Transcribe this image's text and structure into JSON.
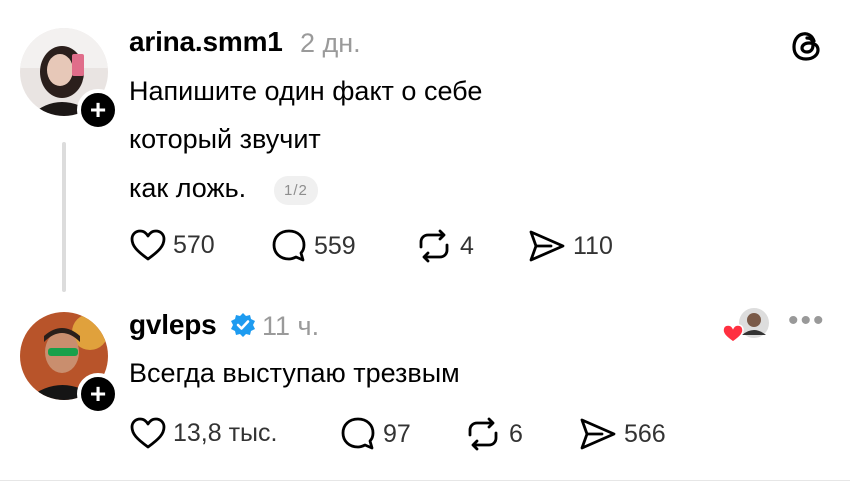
{
  "post1": {
    "username": "arina.smm1",
    "time": "2 дн.",
    "lines": [
      "Напишите один факт о себе",
      "который звучит",
      "как ложь."
    ],
    "pager": "1/2",
    "likes": "570",
    "comments": "559",
    "reposts": "4",
    "shares": "110"
  },
  "post2": {
    "username": "gvleps",
    "time": "11 ч.",
    "text": "Всегда выступаю трезвым",
    "likes": "13,8 тыс.",
    "comments": "97",
    "reposts": "6",
    "shares": "566"
  },
  "icons": {
    "app": "threads-icon",
    "like": "heart-icon",
    "comment": "comment-icon",
    "repost": "repost-icon",
    "share": "send-icon",
    "follow": "plus-icon",
    "verified": "verified-icon",
    "more": "more-icon"
  },
  "colors": {
    "verified": "#1d9bf0",
    "heart": "#ff3040",
    "muted": "#9a9a9a"
  }
}
